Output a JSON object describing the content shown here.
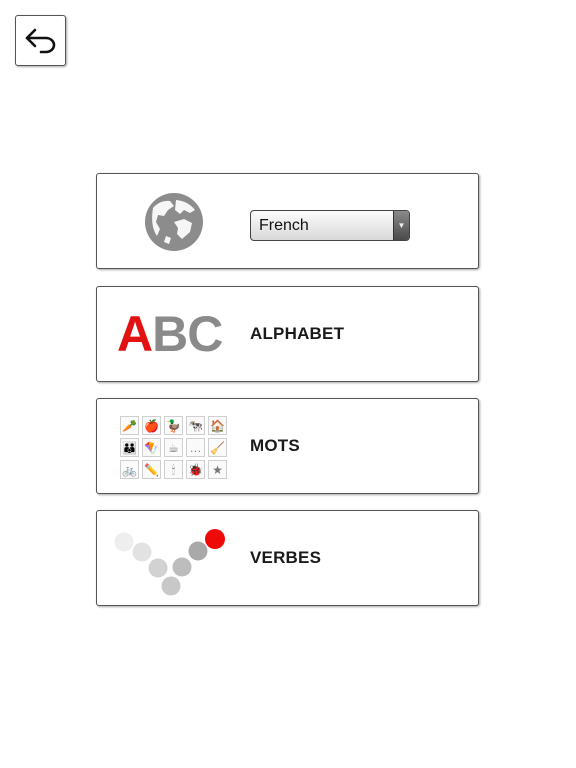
{
  "language": {
    "selected": "French",
    "icon": "globe-icon"
  },
  "menu": {
    "alphabet": {
      "label": "ALPHABET",
      "logo_a": "A",
      "logo_bc": "BC"
    },
    "mots": {
      "label": "MOTS",
      "tiles": [
        "🥕",
        "🍎",
        "🦆",
        "🐄",
        "🏠",
        "👪",
        "🪁",
        "☕",
        "…",
        "🧹",
        "🚲",
        "✏️",
        "🕯",
        "🐞",
        "★"
      ]
    },
    "verbes": {
      "label": "VERBES"
    }
  },
  "colors": {
    "accent_red": "#e31212",
    "icon_gray": "#8a8a8a"
  }
}
